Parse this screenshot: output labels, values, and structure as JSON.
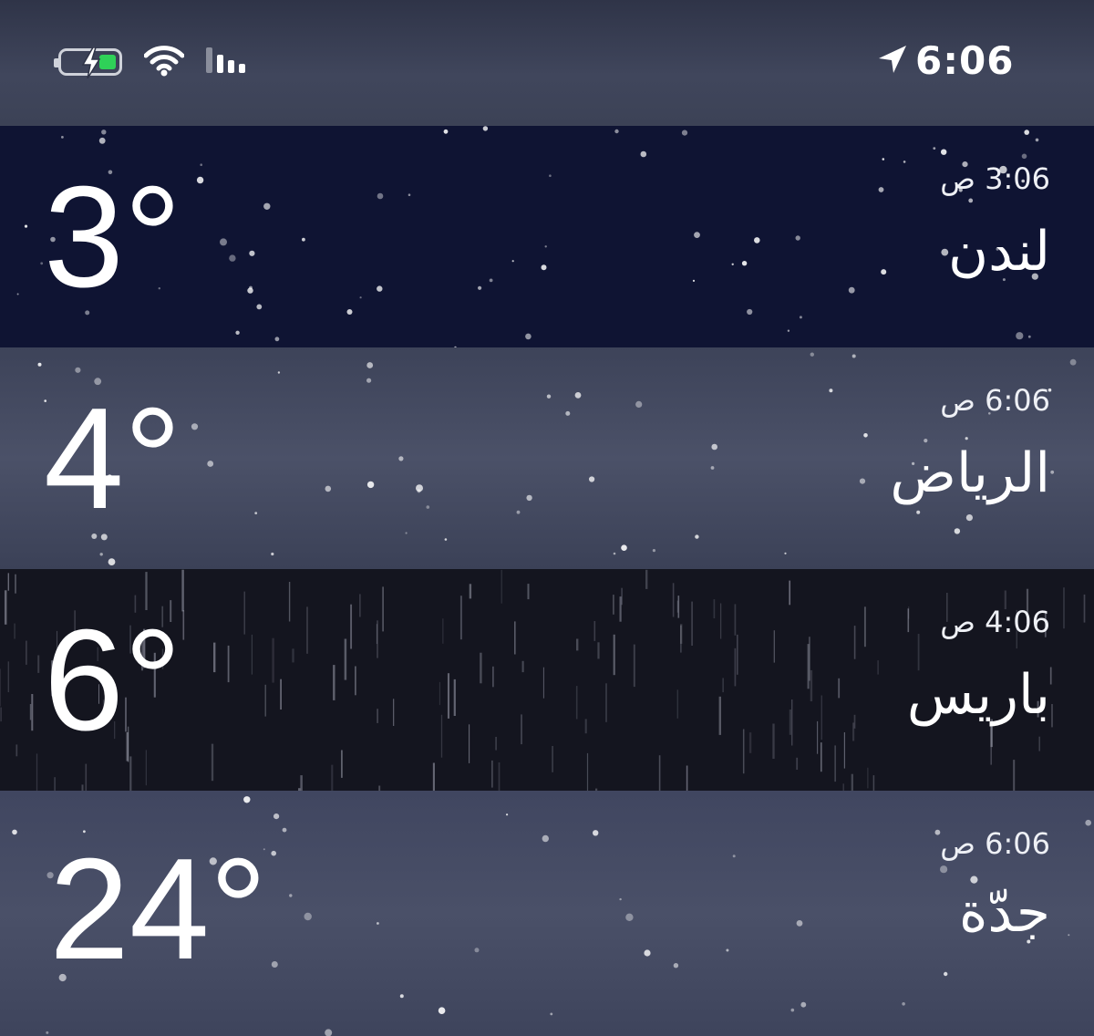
{
  "status_bar": {
    "time": "6:06",
    "battery_icon": "battery-charging-icon",
    "battery_color": "#2fd158",
    "wifi_icon": "wifi-icon",
    "signal_icon": "cellular-signal-icon",
    "location_icon": "location-arrow-icon"
  },
  "cities": [
    {
      "temperature": "3°",
      "local_time": "3:06",
      "time_suffix": "ص",
      "name": "لندن",
      "background": "#0f1433"
    },
    {
      "temperature": "4°",
      "local_time": "6:06",
      "time_suffix": "ص",
      "name": "الرياض",
      "background": "#454b62"
    },
    {
      "temperature": "6°",
      "local_time": "4:06",
      "time_suffix": "ص",
      "name": "باريس",
      "background": "#14151f"
    },
    {
      "temperature": "24°",
      "local_time": "6:06",
      "time_suffix": "ص",
      "name": "جدّة",
      "background": "#454b62"
    }
  ]
}
